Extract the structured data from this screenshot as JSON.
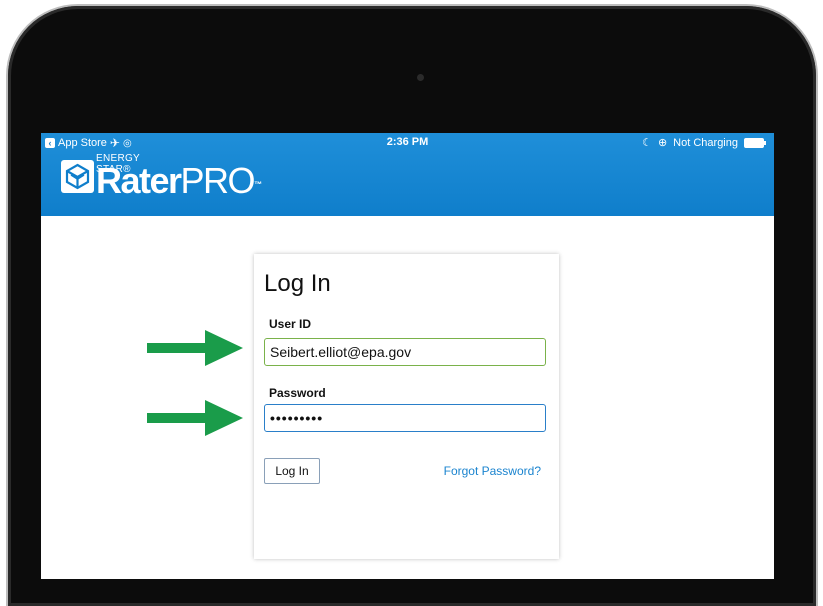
{
  "status_bar": {
    "back_app": "App Store",
    "time": "2:36 PM",
    "charging": "Not Charging"
  },
  "brand": {
    "small": "ENERGY STAR®",
    "name_bold": "Rater",
    "name_light": "PRO",
    "tm": "™"
  },
  "login": {
    "title": "Log In",
    "user_label": "User ID",
    "user_value": "Seibert.elliot@epa.gov",
    "password_label": "Password",
    "password_value": "•••••••••",
    "submit_label": "Log In",
    "forgot_label": "Forgot Password?"
  },
  "colors": {
    "header": "#0f7ecb",
    "arrow": "#1a9c4a",
    "link": "#1b84cf"
  },
  "icons": [
    "back-icon",
    "airplane-icon",
    "wifi-icon",
    "moon-icon",
    "lock-rotation-icon",
    "battery-icon",
    "energy-star-logo-icon",
    "arrow-right-icon"
  ]
}
